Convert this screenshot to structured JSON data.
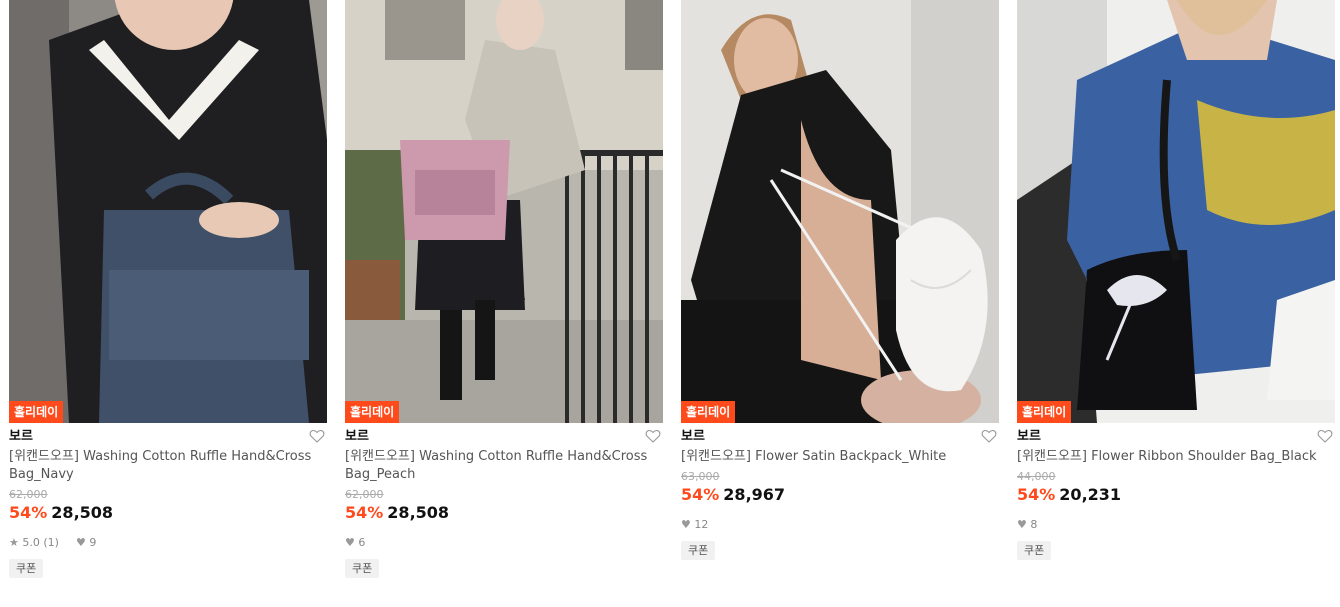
{
  "products": [
    {
      "badge": "홀리데이",
      "brand": "보르",
      "name": "[위캔드오프] Washing Cotton Ruffle Hand&Cross Bag_Navy",
      "original_price": "62,000",
      "discount": "54%",
      "price": "28,508",
      "rating": "5.0 (1)",
      "likes": "9",
      "coupon": "쿠폰"
    },
    {
      "badge": "홀리데이",
      "brand": "보르",
      "name": "[위캔드오프] Washing Cotton Ruffle Hand&Cross Bag_Peach",
      "original_price": "62,000",
      "discount": "54%",
      "price": "28,508",
      "likes": "6",
      "coupon": "쿠폰"
    },
    {
      "badge": "홀리데이",
      "brand": "보르",
      "name": "[위캔드오프] Flower Satin Backpack_White",
      "original_price": "63,000",
      "discount": "54%",
      "price": "28,967",
      "likes": "12",
      "coupon": "쿠폰"
    },
    {
      "badge": "홀리데이",
      "brand": "보르",
      "name": "[위캔드오프] Flower Ribbon Shoulder Bag_Black",
      "original_price": "44,000",
      "discount": "54%",
      "price": "20,231",
      "likes": "8",
      "coupon": "쿠폰"
    }
  ],
  "colors": {
    "accent": "#ff4a1c",
    "badge_bg": "#ff4a1c",
    "strike": "#aaaaaa"
  },
  "icons": {
    "wishlist": "heart-outline-icon",
    "rating": "star-icon",
    "likes": "heart-filled-icon"
  }
}
